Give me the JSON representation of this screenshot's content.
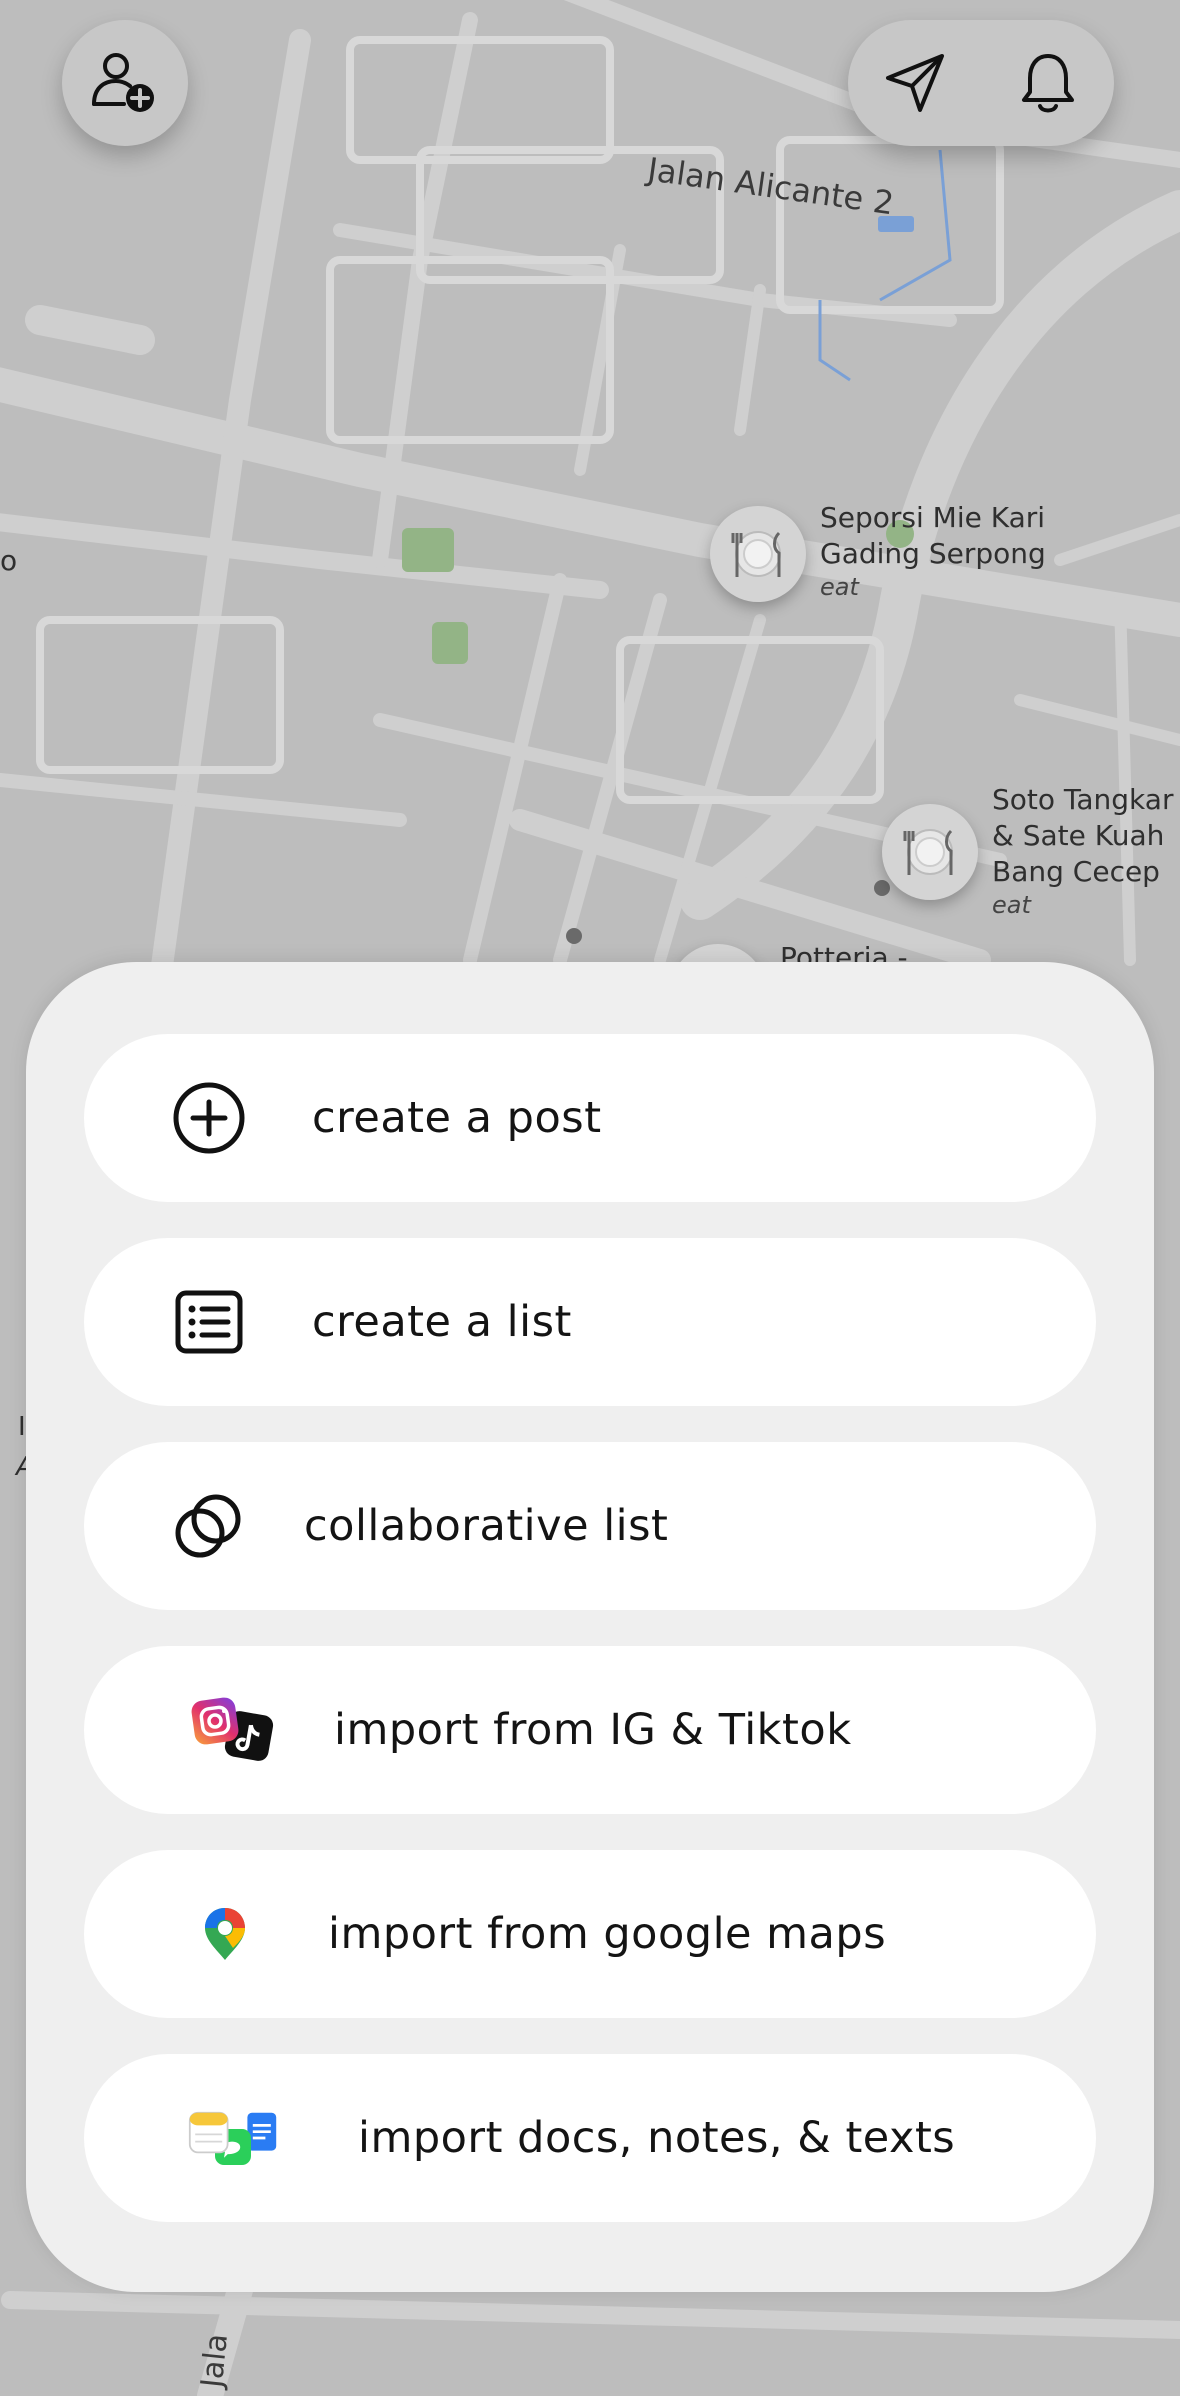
{
  "map": {
    "street_top": "Jalan Alicante 2",
    "street_bottom": "Jala",
    "places": [
      {
        "name_lines": [
          "Seporsi Mie Kari",
          "Gading Serpong"
        ],
        "category": "eat"
      },
      {
        "name_lines": [
          "Soto Tangkar",
          "& Sate Kuah",
          "Bang Cecep"
        ],
        "category": "eat"
      },
      {
        "name_lines": [
          "Potteria -"
        ],
        "category": ""
      }
    ],
    "edge_fragments": [
      "o",
      "I",
      "A"
    ]
  },
  "header": {
    "add_friend_icon": "user-plus-icon",
    "send_icon": "paper-plane-icon",
    "notifications_icon": "bell-icon"
  },
  "menu": {
    "items": [
      {
        "label": "create a post",
        "icon": "plus-circle-icon"
      },
      {
        "label": "create a list",
        "icon": "list-icon"
      },
      {
        "label": "collaborative list",
        "icon": "overlapping-circles-icon"
      },
      {
        "label": "import from IG & Tiktok",
        "icon": "instagram-tiktok-icon"
      },
      {
        "label": "import from google maps",
        "icon": "google-maps-pin-icon"
      },
      {
        "label": "import docs, notes, & texts",
        "icon": "docs-notes-messages-icon"
      }
    ]
  },
  "colors": {
    "map_background": "#bdbdbd",
    "road": "#cdcdcd",
    "park": "#93b486",
    "sheet": "#efefef",
    "button": "#ffffff",
    "text": "#141414"
  }
}
